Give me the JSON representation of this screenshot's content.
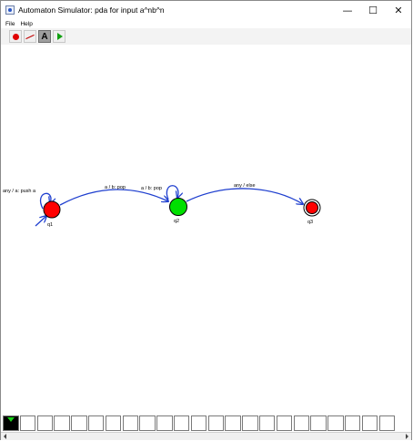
{
  "window": {
    "title": "Automaton Simulator: pda for input a^nb^n",
    "controls": {
      "minimize": "—",
      "maximize": "☐",
      "close": "✕"
    }
  },
  "menu": {
    "items": [
      "File",
      "Help"
    ]
  },
  "toolbar": {
    "tools": [
      {
        "name": "state-tool",
        "icon": "red-circle-icon"
      },
      {
        "name": "transition-tool",
        "icon": "arrow-icon"
      },
      {
        "name": "text-tool",
        "icon": "text-icon",
        "label": "A",
        "selected": true
      },
      {
        "name": "run-tool",
        "icon": "play-icon"
      }
    ]
  },
  "automaton": {
    "states": [
      {
        "id": "q1",
        "label": "q1",
        "color": "#ff0000",
        "start": true,
        "final": false
      },
      {
        "id": "q2",
        "label": "q2",
        "color": "#00e000",
        "start": false,
        "final": false
      },
      {
        "id": "q3",
        "label": "q3",
        "color": "#ff0000",
        "start": false,
        "final": true
      }
    ],
    "transitions": [
      {
        "from": "q1",
        "to": "q1",
        "label": "any / a: push a"
      },
      {
        "from": "q1",
        "to": "q2",
        "label": "a / b: pop"
      },
      {
        "from": "q2",
        "to": "q2",
        "label": "a / b: pop"
      },
      {
        "from": "q2",
        "to": "q3",
        "label": "any / else"
      }
    ],
    "edge_color": "#1f3fcf"
  },
  "tape": {
    "cell_count": 23,
    "head_index": 0,
    "cells": []
  }
}
